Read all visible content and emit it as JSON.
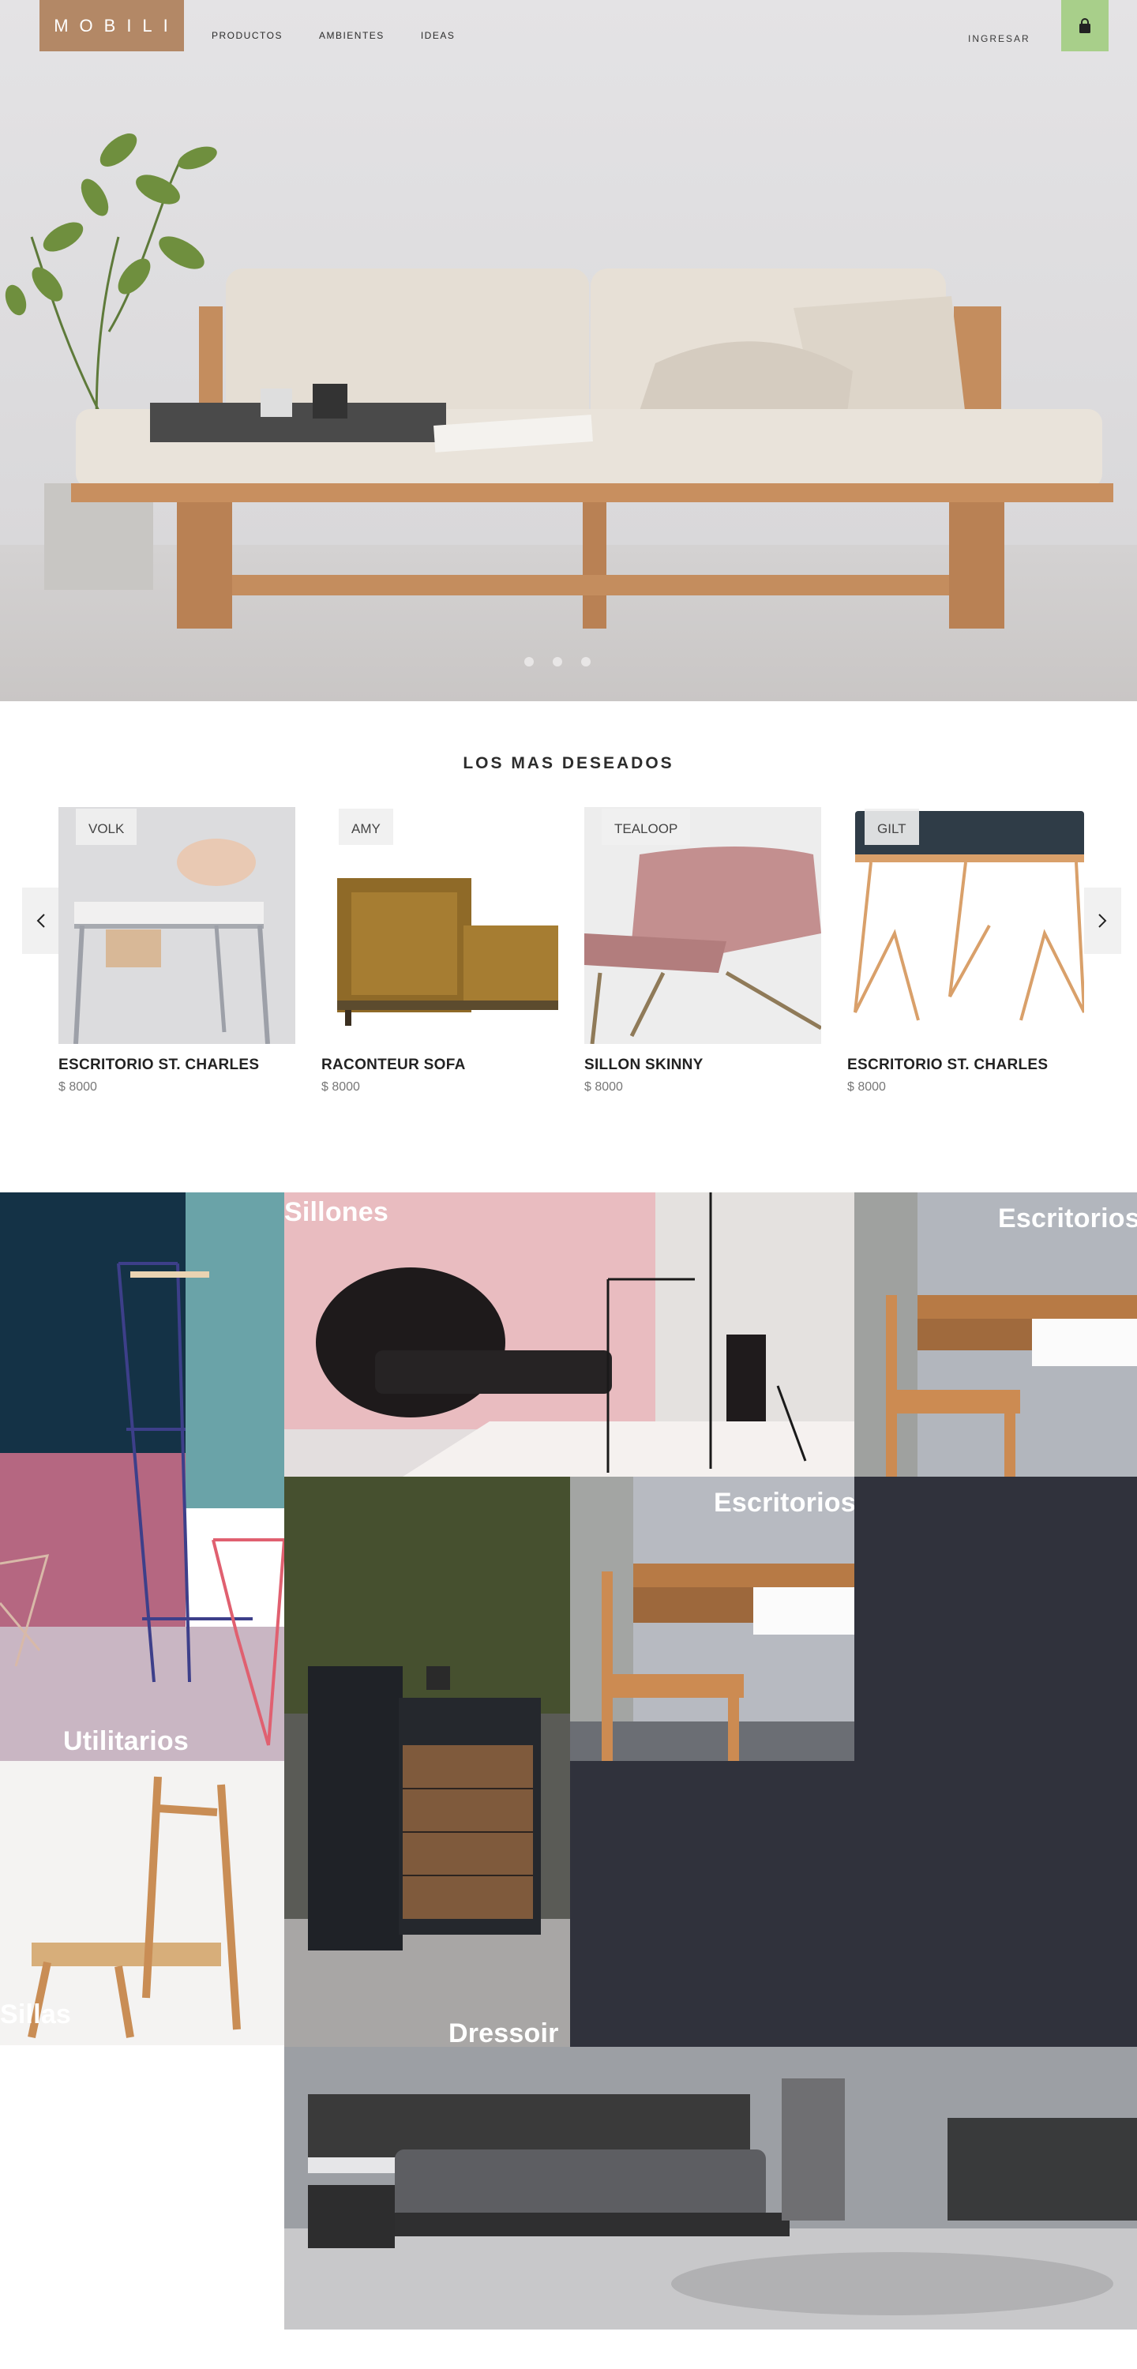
{
  "header": {
    "logo": "MOBILI",
    "nav": [
      "PRODUCTOS",
      "AMBIENTES",
      "IDEAS"
    ],
    "login": "INGRESAR",
    "cart_icon": "shopping-bag-icon",
    "cart_color": "#a8cf8a",
    "logo_color": "#b38866"
  },
  "hero": {
    "slides": 3,
    "active_slide": 1
  },
  "featured": {
    "title": "LOS MAS DESEADOS",
    "products": [
      {
        "brand": "VOLK",
        "name": "ESCRITORIO ST. CHARLES",
        "price": "$ 8000"
      },
      {
        "brand": "AMY",
        "name": "RACONTEUR SOFA",
        "price": "$ 8000"
      },
      {
        "brand": "TEALOOP",
        "name": "SILLON SKINNY",
        "price": "$ 8000"
      },
      {
        "brand": "GILT",
        "name": "ESCRITORIO ST. CHARLES",
        "price": "$ 8000"
      }
    ],
    "prev_icon": "chevron-left-icon",
    "next_icon": "chevron-right-icon"
  },
  "categories": {
    "sillones": "Sillones",
    "escritorios_top": "Escritorios",
    "escritorios_mid": "Escritorios",
    "utilitarios": "Utilitarios",
    "sillas": "Sillas",
    "dressoir": "Dressoir",
    "dark_color": "#30323c"
  }
}
